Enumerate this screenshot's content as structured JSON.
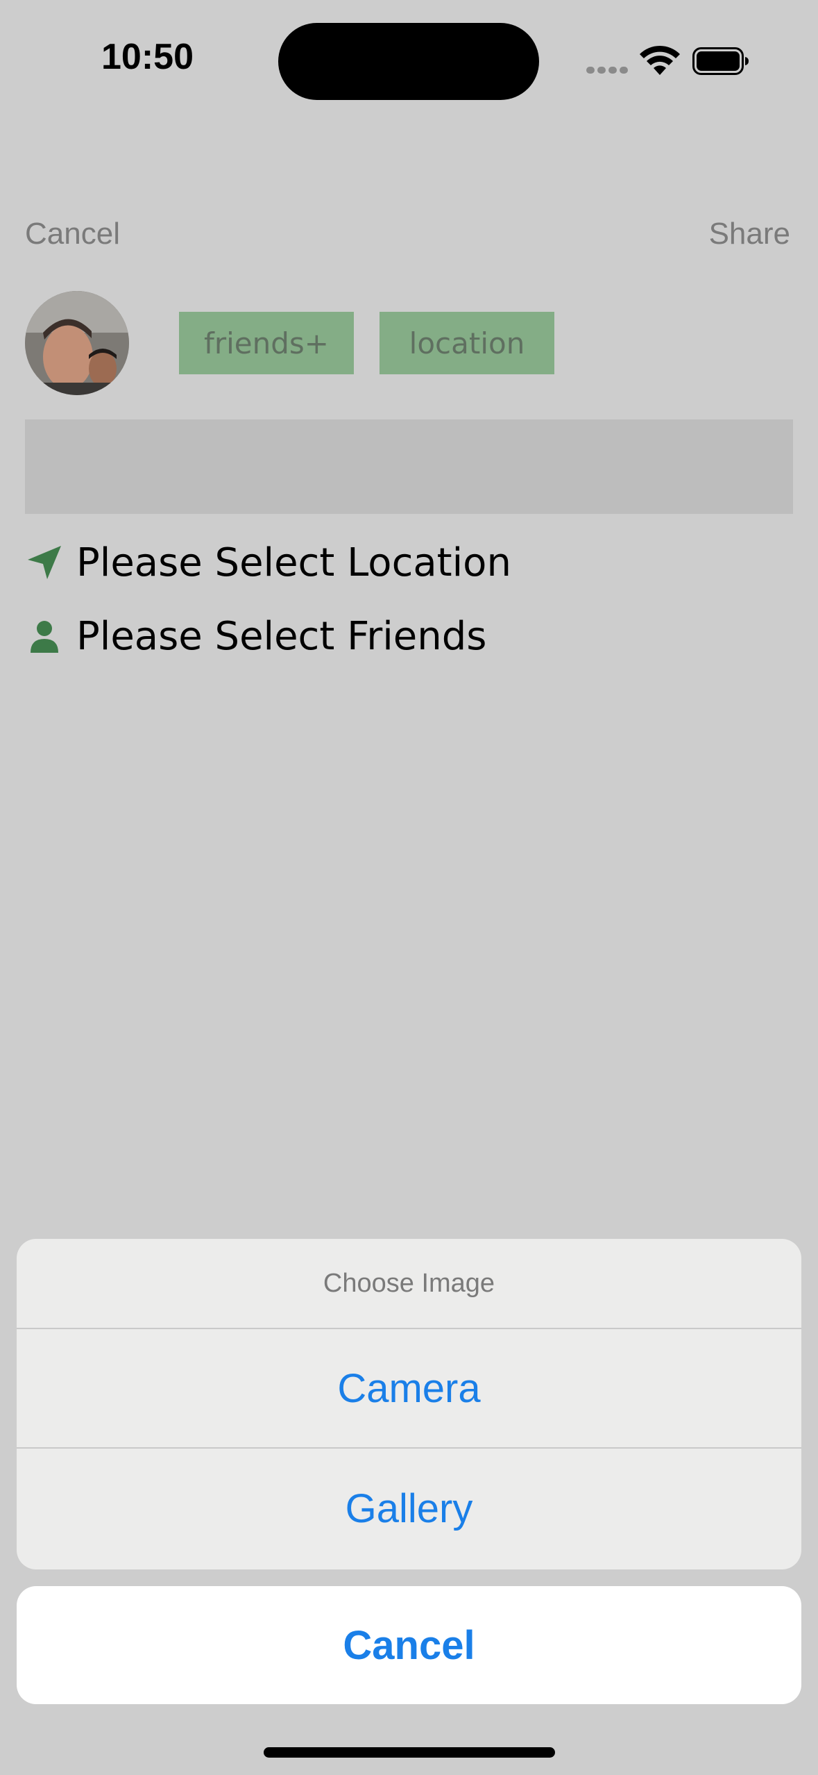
{
  "status_bar": {
    "time": "10:50"
  },
  "nav": {
    "cancel_label": "Cancel",
    "share_label": "Share"
  },
  "tags": {
    "friends_label": "friends+",
    "location_label": "location"
  },
  "selectors": {
    "location_label": "Please Select Location",
    "friends_label": "Please Select Friends"
  },
  "action_sheet": {
    "title": "Choose Image",
    "options": [
      {
        "label": "Camera"
      },
      {
        "label": "Gallery"
      }
    ],
    "cancel_label": "Cancel"
  },
  "colors": {
    "background_dimmed": "#cdcdcd",
    "accent_green": "#3d7a48",
    "tag_green": "#84ad86",
    "action_blue": "#1a7fe8"
  },
  "icons": {
    "location": "navigation-arrow-icon",
    "friends": "person-icon"
  }
}
